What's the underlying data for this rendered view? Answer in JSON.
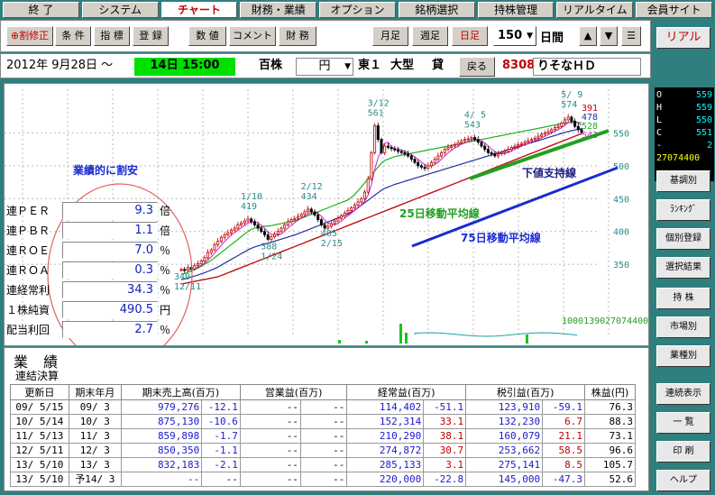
{
  "tabs": [
    "終 了",
    "システム",
    "チャート",
    "財務・業績",
    "オプション",
    "銘柄選択",
    "持株管理",
    "リアルタイム",
    "会員サイト"
  ],
  "active_tab": 2,
  "toolbar": {
    "buttons": [
      "⊕割修正",
      "条 件",
      "指 標",
      "登 録",
      "数 値",
      "コメント",
      "財 務"
    ],
    "period": [
      "月足",
      "週足",
      "日足"
    ],
    "period_active": "日足",
    "bars_value": "150",
    "bars_unit": "日間",
    "arrows": [
      "▲",
      "▼",
      "☰"
    ]
  },
  "infobar": {
    "start_date": "2012年  9月28日  〜",
    "end_date": "14日  15:00",
    "unit": "百株",
    "currency": "円",
    "market": "東１",
    "size": "大型",
    "credit": "貸",
    "back": "戻る",
    "code": "8308",
    "name": "りそなＨＤ"
  },
  "side": {
    "realtime": "リアル",
    "ohlc": [
      {
        "k": "O",
        "v": "559"
      },
      {
        "k": "H",
        "v": "559"
      },
      {
        "k": "L",
        "v": "550"
      },
      {
        "k": "C",
        "v": "551"
      },
      {
        "k": "-",
        "v": "2"
      }
    ],
    "volume": "27074400",
    "buttons": [
      "基調別",
      "ﾗﾝｷﾝｸﾞ",
      "個別登録",
      "選択結果",
      "持 株",
      "市場別",
      "業種別",
      "連続表示",
      "一 覧",
      "印 刷",
      "ヘルプ"
    ]
  },
  "chart_labels": {
    "headline": "業績的に割安",
    "support": "下値支持線",
    "ma25": "25日移動平均線",
    "ma75": "75日移動平均線",
    "volume_readout": "10001390",
    "volume_readout2": "27074400",
    "top_values": [
      "391",
      "478",
      "528",
      "543"
    ]
  },
  "chart_data": {
    "type": "line",
    "y_ticks": [
      350,
      400,
      450,
      500,
      550
    ],
    "ylim": [
      320,
      600
    ],
    "annotations": [
      {
        "label": "12/11",
        "value": "340"
      },
      {
        "label": "1/10",
        "value": "419"
      },
      {
        "label": "1/24",
        "value": "388"
      },
      {
        "label": "2/12",
        "value": "434"
      },
      {
        "label": "2/15",
        "value": "405"
      },
      {
        "label": "3/12",
        "value": "561"
      },
      {
        "label": "4/ 5",
        "value": "543"
      },
      {
        "label": "5/ 9",
        "value": "574"
      }
    ],
    "close": [
      342,
      341,
      345,
      343,
      348,
      351,
      355,
      360,
      368,
      372,
      380,
      385,
      391,
      395,
      398,
      402,
      405,
      410,
      413,
      416,
      419,
      415,
      410,
      405,
      400,
      395,
      388,
      392,
      396,
      400,
      405,
      410,
      415,
      418,
      420,
      423,
      426,
      430,
      434,
      430,
      425,
      418,
      410,
      405,
      408,
      412,
      416,
      420,
      424,
      428,
      432,
      436,
      440,
      445,
      450,
      460,
      480,
      520,
      561,
      540,
      520,
      530,
      528,
      526,
      524,
      522,
      520,
      518,
      515,
      510,
      505,
      500,
      498,
      496,
      500,
      505,
      510,
      515,
      520,
      525,
      528,
      530,
      532,
      535,
      538,
      540,
      541,
      543,
      540,
      536,
      530,
      525,
      520,
      518,
      515,
      518,
      520,
      522,
      525,
      528,
      530,
      532,
      534,
      536,
      538,
      540,
      542,
      545,
      548,
      550,
      552,
      555,
      558,
      560,
      565,
      570,
      574,
      568,
      560,
      555,
      551
    ],
    "ma25": [
      335,
      336,
      338,
      340,
      342,
      344,
      347,
      350,
      353,
      356,
      360,
      364,
      368,
      372,
      376,
      380,
      384,
      388,
      392,
      396,
      400,
      403,
      405,
      406,
      407,
      408,
      408,
      409,
      410,
      411,
      412,
      413,
      414,
      415,
      416,
      418,
      420,
      422,
      424,
      426,
      428,
      430,
      432,
      434,
      436,
      438,
      440,
      442,
      444,
      446,
      448,
      452,
      456,
      462,
      468,
      474,
      480,
      486,
      492,
      498,
      504,
      508,
      510,
      512,
      514,
      515,
      516,
      517,
      518,
      519,
      520,
      521,
      522,
      523,
      524,
      525,
      526,
      527,
      528,
      529,
      530,
      531,
      532,
      533,
      534,
      535,
      536,
      537,
      538,
      539,
      540,
      541,
      542,
      543,
      544,
      545,
      546,
      547,
      548,
      549,
      550,
      551,
      552,
      553,
      554,
      555,
      556,
      557,
      558,
      559,
      560,
      561,
      562,
      563,
      564,
      565,
      566,
      566,
      566,
      566,
      566
    ],
    "ma75": [
      320,
      321,
      322,
      323,
      324,
      325,
      326,
      327,
      328,
      329,
      330,
      331,
      333,
      335,
      337,
      339,
      341,
      343,
      345,
      347,
      349,
      351,
      353,
      355,
      357,
      359,
      361,
      363,
      365,
      367,
      369,
      371,
      373,
      375,
      377,
      379,
      381,
      383,
      385,
      387,
      389,
      391,
      393,
      395,
      397,
      399,
      401,
      403,
      405,
      407,
      409,
      411,
      413,
      415,
      417,
      419,
      421,
      423,
      425,
      427,
      429,
      431,
      433,
      435,
      437,
      439,
      441,
      443,
      445,
      447,
      449,
      451,
      453,
      455,
      457,
      459,
      461,
      463,
      465,
      467,
      469,
      471,
      473,
      475,
      477,
      479,
      481,
      483,
      485,
      487,
      489,
      491,
      493,
      495,
      497,
      499,
      501,
      503,
      505,
      507,
      509,
      511,
      513,
      515,
      517,
      519,
      521,
      523,
      525,
      527,
      529,
      531,
      533,
      535,
      537,
      539,
      541,
      543,
      545,
      547,
      549
    ]
  },
  "metrics": [
    {
      "label": "連ＰＥＲ",
      "value": "9.3",
      "unit": "倍"
    },
    {
      "label": "連ＰＢＲ",
      "value": "1.1",
      "unit": "倍"
    },
    {
      "label": "連ＲＯＥ",
      "value": "7.0",
      "unit": "％"
    },
    {
      "label": "連ＲＯＡ",
      "value": "0.3",
      "unit": "％"
    },
    {
      "label": "連経常利",
      "value": "34.3",
      "unit": "％"
    },
    {
      "label": "１株純資",
      "value": "490.5",
      "unit": "円"
    },
    {
      "label": "配当利回",
      "value": "2.7",
      "unit": "％"
    }
  ],
  "performance": {
    "title": "業 績",
    "subtitle": "連結決算",
    "headers": [
      "更新日",
      "期末年月",
      "期末売上高(百万)",
      "営業益(百万)",
      "経常益(百万)",
      "税引益(百万)",
      "株益(円)"
    ],
    "rows": [
      [
        "09/ 5/15",
        "09/ 3",
        "979,276",
        "-12.1",
        "--",
        "--",
        "114,402",
        "-51.1",
        "123,910",
        "-59.1",
        "76.3"
      ],
      [
        "10/ 5/14",
        "10/ 3",
        "875,130",
        "-10.6",
        "--",
        "--",
        "152,314",
        "33.1",
        "132,230",
        "6.7",
        "88.3"
      ],
      [
        "11/ 5/13",
        "11/ 3",
        "859,898",
        "-1.7",
        "--",
        "--",
        "210,290",
        "38.1",
        "160,079",
        "21.1",
        "73.1"
      ],
      [
        "12/ 5/11",
        "12/ 3",
        "850,350",
        "-1.1",
        "--",
        "--",
        "274,872",
        "30.7",
        "253,662",
        "58.5",
        "96.6"
      ],
      [
        "13/ 5/10",
        "13/ 3",
        "832,183",
        "-2.1",
        "--",
        "--",
        "285,133",
        "3.1",
        "275,141",
        "8.5",
        "105.7"
      ],
      [
        "13/ 5/10",
        "予14/ 3",
        "--",
        "--",
        "--",
        "--",
        "220,000",
        "-22.8",
        "145,000",
        "-47.3",
        "52.6"
      ]
    ]
  }
}
